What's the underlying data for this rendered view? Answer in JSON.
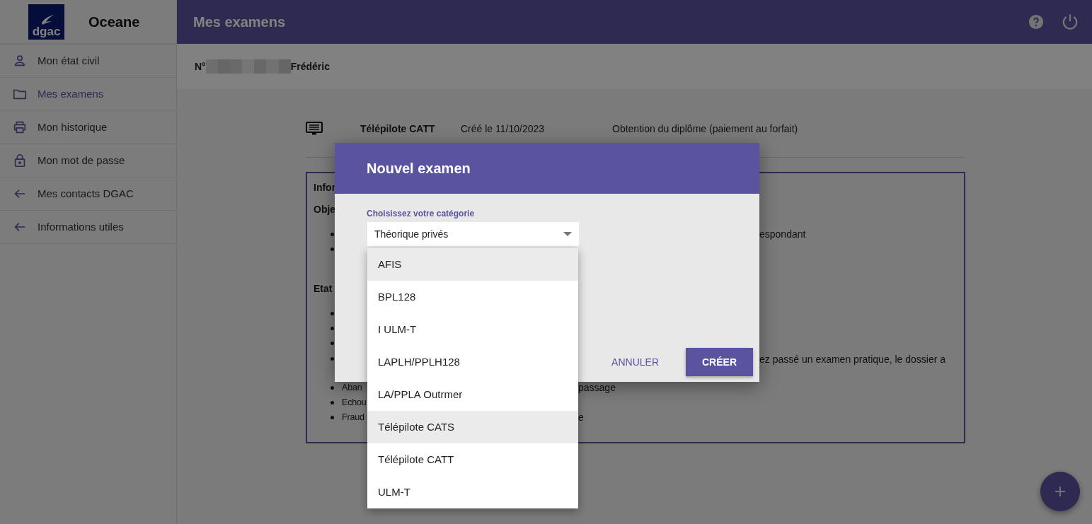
{
  "app": {
    "logo_text": "dgac",
    "name": "Oceane"
  },
  "sidebar": {
    "items": [
      {
        "label": "Mon état civil",
        "selected": false
      },
      {
        "label": "Mes examens",
        "selected": true
      },
      {
        "label": "Mon historique",
        "selected": false
      },
      {
        "label": "Mon mot de passe",
        "selected": false
      },
      {
        "label": "Mes contacts DGAC",
        "selected": false
      },
      {
        "label": "Informations utiles",
        "selected": false
      }
    ]
  },
  "header": {
    "title": "Mes examens"
  },
  "student": {
    "number_label": "N°",
    "first_name": "Frédéric"
  },
  "exam": {
    "name": "Télépilote CATT",
    "created": "Créé le 11/10/2023",
    "purpose": "Obtention du diplôme (paiement au forfait)"
  },
  "info_box": {
    "rows": [
      {
        "kind": "heading",
        "left": "Infor"
      },
      {
        "kind": "heading",
        "left": "Obje"
      },
      {
        "kind": "bullet-far",
        "right": "espondant"
      },
      {
        "kind": "bullet"
      },
      {
        "kind": "heading",
        "left": "Etat"
      },
      {
        "kind": "bullet"
      },
      {
        "kind": "bullet"
      },
      {
        "kind": "bullet"
      },
      {
        "kind": "bullet-long",
        "right": "ez passé un examen pratique, le dossier a"
      },
      {
        "kind": "bullet-near",
        "left": "Aban",
        "right": "passage"
      },
      {
        "kind": "bullet",
        "left": "Echou"
      },
      {
        "kind": "bullet-near",
        "left": "Fraud",
        "right": "e"
      }
    ]
  },
  "dialog": {
    "title": "Nouvel examen",
    "field_label": "Choisissez votre catégorie",
    "field_value": "Théorique privés",
    "buttons": [
      {
        "label": "ANNULER",
        "kind": "text"
      },
      {
        "label": "CRÉER",
        "kind": "primary"
      }
    ]
  },
  "menu": {
    "items": [
      {
        "label": "AFIS",
        "highlighted": true
      },
      {
        "label": "BPL128",
        "highlighted": false
      },
      {
        "label": "I ULM-T",
        "highlighted": false
      },
      {
        "label": "LAPLH/PPLH128",
        "highlighted": false
      },
      {
        "label": "LA/PPLA Outrmer",
        "highlighted": false
      },
      {
        "label": "Télépilote CATS",
        "highlighted": true
      },
      {
        "label": "Télépilote CATT",
        "highlighted": false
      },
      {
        "label": "ULM-T",
        "highlighted": false
      }
    ]
  }
}
